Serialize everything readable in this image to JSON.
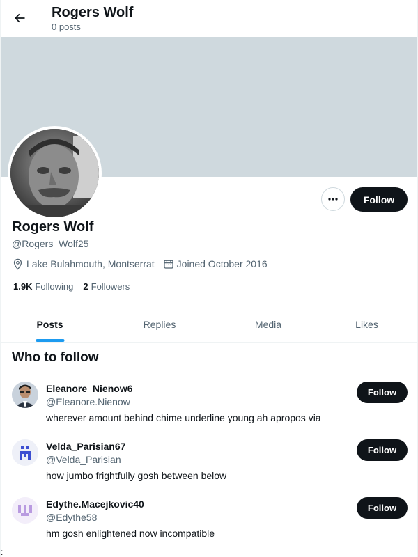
{
  "header": {
    "title": "Rogers Wolf",
    "subtitle": "0 posts",
    "back_icon": "arrow-left-icon"
  },
  "colors": {
    "banner": "#cfd9de",
    "primary_button": "#0f1419",
    "tab_indicator": "#1d9bf0",
    "secondary_text": "#536471"
  },
  "profile": {
    "display_name": "Rogers Wolf",
    "handle": "@Rogers_Wolf25",
    "location": "Lake Bulahmouth, Montserrat",
    "joined": "Joined October 2016",
    "following_count": "1.9K",
    "following_label": "Following",
    "followers_count": "2",
    "followers_label": "Followers",
    "follow_label": "Follow",
    "more_icon": "more-dots-icon"
  },
  "tabs": [
    {
      "label": "Posts",
      "active": true
    },
    {
      "label": "Replies",
      "active": false
    },
    {
      "label": "Media",
      "active": false
    },
    {
      "label": "Likes",
      "active": false
    }
  ],
  "who_to_follow": {
    "title": "Who to follow",
    "suggestions": [
      {
        "name": "Eleanore_Nienow6",
        "handle": "@Eleanore.Nienow",
        "bio": "wherever amount behind chime underline young ah apropos via",
        "follow_label": "Follow"
      },
      {
        "name": "Velda_Parisian67",
        "handle": "@Velda_Parisian",
        "bio": "how jumbo frightfully gosh between below",
        "follow_label": "Follow"
      },
      {
        "name": "Edythe.Macejkovic40",
        "handle": "@Edythe58",
        "bio": "hm gosh enlightened now incompatible",
        "follow_label": "Follow"
      }
    ]
  },
  "footer_mark": ":"
}
